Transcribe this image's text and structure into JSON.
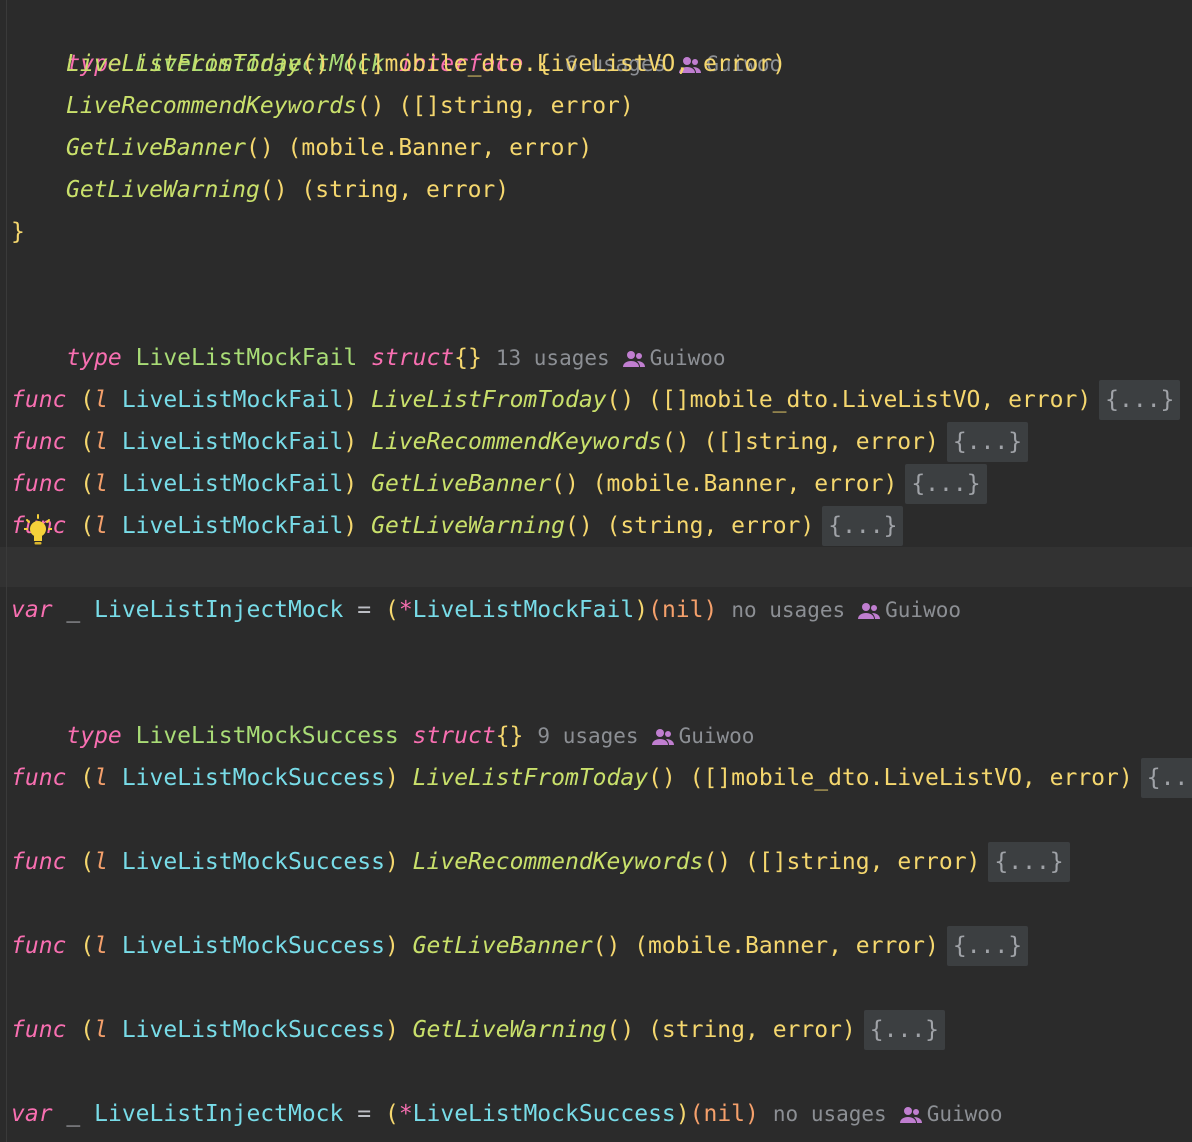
{
  "editor": {
    "interface_decl": {
      "kw_type": "type",
      "name": "LiveListInjectMock",
      "kw_interface": "interface",
      "open": "{",
      "usages": "6 usages",
      "author": "Guiwoo",
      "methods": [
        {
          "name": "LiveListFromToday",
          "sig": "() ([]mobile_dto.LiveListVO, error)"
        },
        {
          "name": "LiveRecommendKeywords",
          "sig": "() ([]string, error)"
        },
        {
          "name": "GetLiveBanner",
          "sig": "() (mobile.Banner, error)"
        },
        {
          "name": "GetLiveWarning",
          "sig": "() (string, error)"
        }
      ],
      "close": "}"
    },
    "fail_struct": {
      "kw_type": "type",
      "name": "LiveListMockFail",
      "kw_struct": "struct",
      "body": "{}",
      "usages": "13 usages",
      "author": "Guiwoo"
    },
    "fail_funcs": [
      {
        "kw": "func",
        "recv_open": "(",
        "recv_var": "l",
        "recv_type": "LiveListMockFail",
        "recv_close": ")",
        "name": "LiveListFromToday",
        "sig": "() ([]mobile_dto.LiveListVO, error)",
        "fold": "{...}"
      },
      {
        "kw": "func",
        "recv_open": "(",
        "recv_var": "l",
        "recv_type": "LiveListMockFail",
        "recv_close": ")",
        "name": "LiveRecommendKeywords",
        "sig": "() ([]string, error)",
        "fold": "{...}"
      },
      {
        "kw": "func",
        "recv_open": "(",
        "recv_var": "l",
        "recv_type": "LiveListMockFail",
        "recv_close": ")",
        "name": "GetLiveBanner",
        "sig": "() (mobile.Banner, error)",
        "fold": "{...}"
      },
      {
        "kw": "func",
        "recv_open": "(",
        "recv_var": "l",
        "recv_type": "LiveListMockFail",
        "recv_close": ")",
        "name": "GetLiveWarning",
        "sig": "() (string, error)",
        "fold": "{...}"
      }
    ],
    "fail_var": {
      "kw": "var",
      "blank": "_",
      "type": "LiveListInjectMock",
      "eq": "=",
      "cast_open": "(",
      "star": "*",
      "cast_type": "LiveListMockFail",
      "cast_close": ")",
      "value": "(nil)",
      "usages": "no usages",
      "author": "Guiwoo"
    },
    "success_struct": {
      "kw_type": "type",
      "name": "LiveListMockSuccess",
      "kw_struct": "struct",
      "body": "{}",
      "usages": "9 usages",
      "author": "Guiwoo"
    },
    "success_funcs": [
      {
        "kw": "func",
        "recv_open": "(",
        "recv_var": "l",
        "recv_type": "LiveListMockSuccess",
        "recv_close": ")",
        "name": "LiveListFromToday",
        "sig": "() ([]mobile_dto.LiveListVO, error)",
        "fold": "{..."
      },
      {
        "kw": "func",
        "recv_open": "(",
        "recv_var": "l",
        "recv_type": "LiveListMockSuccess",
        "recv_close": ")",
        "name": "LiveRecommendKeywords",
        "sig": "() ([]string, error)",
        "fold": "{...}"
      },
      {
        "kw": "func",
        "recv_open": "(",
        "recv_var": "l",
        "recv_type": "LiveListMockSuccess",
        "recv_close": ")",
        "name": "GetLiveBanner",
        "sig": "() (mobile.Banner, error)",
        "fold": "{...}"
      },
      {
        "kw": "func",
        "recv_open": "(",
        "recv_var": "l",
        "recv_type": "LiveListMockSuccess",
        "recv_close": ")",
        "name": "GetLiveWarning",
        "sig": "() (string, error)",
        "fold": "{...}"
      }
    ],
    "success_var": {
      "kw": "var",
      "blank": "_",
      "type": "LiveListInjectMock",
      "eq": "=",
      "cast_open": "(",
      "star": "*",
      "cast_type": "LiveListMockSuccess",
      "cast_close": ")",
      "value": "(nil)",
      "usages": "no usages",
      "author": "Guiwoo"
    }
  }
}
